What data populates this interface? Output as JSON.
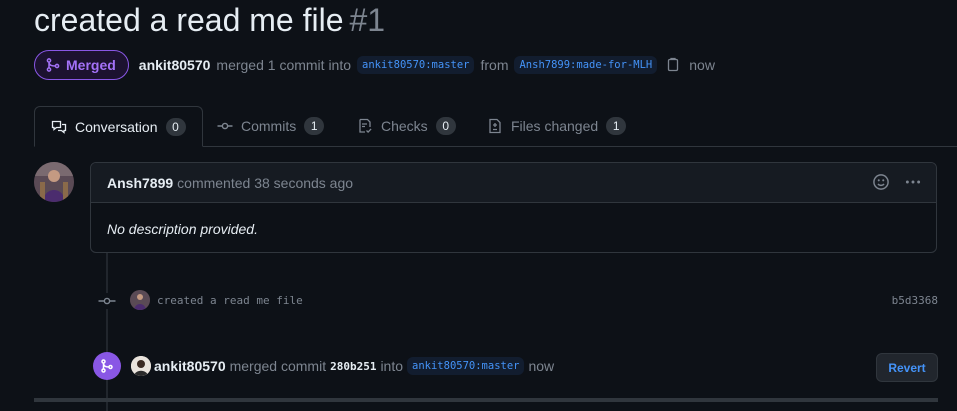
{
  "pr": {
    "title": "created a read me file",
    "number": "#1",
    "status": "Merged",
    "author": "ankit80570",
    "merge_text": "merged 1 commit into",
    "base_branch": "ankit80570:master",
    "from_text": "from",
    "head_branch": "Ansh7899:made-for-MLH",
    "time": "now"
  },
  "tabs": [
    {
      "label": "Conversation",
      "count": "0",
      "icon": "comment-discussion-icon",
      "active": true
    },
    {
      "label": "Commits",
      "count": "1",
      "icon": "git-commit-icon"
    },
    {
      "label": "Checks",
      "count": "0",
      "icon": "checklist-icon"
    },
    {
      "label": "Files changed",
      "count": "1",
      "icon": "file-diff-icon"
    }
  ],
  "comment": {
    "author": "Ansh7899",
    "action": "commented 38 seconds ago",
    "body": "No description provided."
  },
  "commit": {
    "message": "created a read me file",
    "sha": "b5d3368"
  },
  "merge_event": {
    "author": "ankit80570",
    "text": "merged commit",
    "sha": "280b251",
    "into": "into",
    "branch": "ankit80570:master",
    "time": "now",
    "revert_label": "Revert"
  },
  "colors": {
    "background": "#0d1117",
    "merged_purple": "#8957e5",
    "link_blue": "#4493f8",
    "muted": "#7d8590"
  }
}
